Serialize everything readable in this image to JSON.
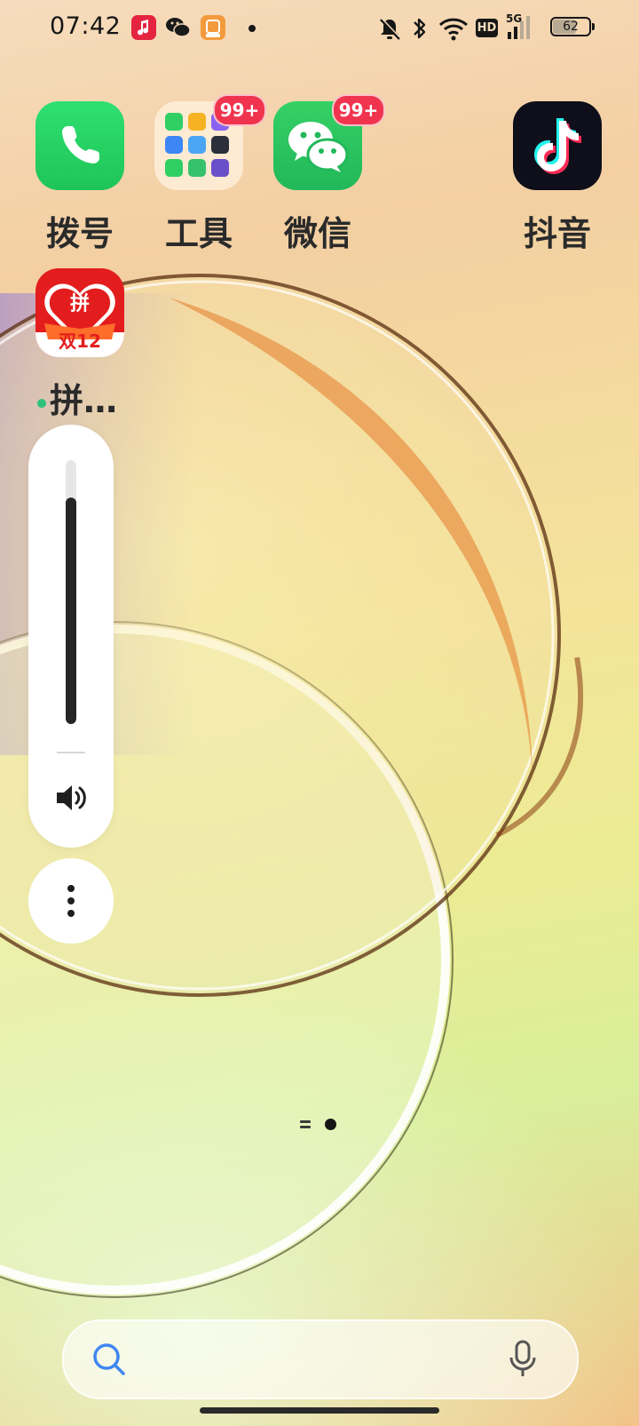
{
  "status_bar": {
    "time": "07:42",
    "notification_icons": [
      "music-icon",
      "wechat-icon",
      "app-notification-icon",
      "more-dot-icon"
    ],
    "system_icons": [
      "mute-icon",
      "bluetooth-icon",
      "wifi-icon",
      "hd-icon",
      "cellular-5g-icon"
    ],
    "network_label": "5G",
    "hd_label": "HD",
    "battery": "62"
  },
  "apps": [
    {
      "label": "拨号",
      "icon": "phone-icon"
    },
    {
      "label": "工具",
      "icon": "tools-folder-icon",
      "badge": "99+"
    },
    {
      "label": "微信",
      "icon": "wechat-icon",
      "badge": "99+"
    },
    {
      "label": "抖音",
      "icon": "douyin-icon"
    },
    {
      "label": "拼…",
      "icon": "pinduoduo-icon",
      "sub_label": "双12",
      "logo_text": "拼",
      "new_indicator": true
    }
  ],
  "volume": {
    "level": 0.86,
    "icon": "speaker-icon",
    "more_icon": "more-vertical-icon"
  },
  "page_indicator": {
    "pages": 2,
    "current": 2
  },
  "search": {
    "placeholder": "",
    "left_icon": "search-icon",
    "right_icon": "microphone-icon"
  },
  "colors": {
    "badge": "#f0344f",
    "phone": "#27d165",
    "wechat": "#2dc55e",
    "pdd": "#e31d1d"
  }
}
